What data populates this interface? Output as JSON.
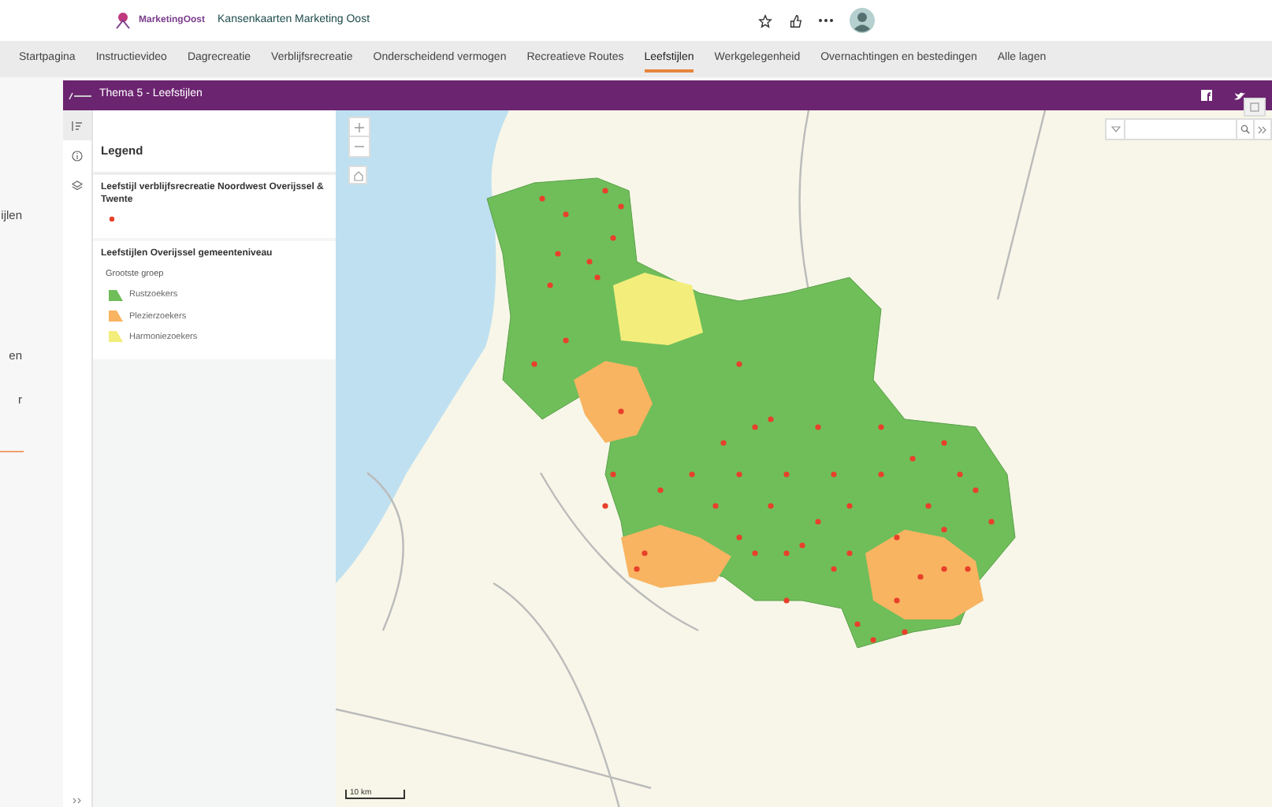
{
  "header": {
    "logo_text": "MarketingOost",
    "title": "Kansenkaarten Marketing Oost"
  },
  "nav": [
    {
      "label": "Startpagina",
      "selected": false
    },
    {
      "label": "Instructievideo",
      "selected": false
    },
    {
      "label": "Dagrecreatie",
      "selected": false
    },
    {
      "label": "Verblijfsrecreatie",
      "selected": false
    },
    {
      "label": "Onderscheidend vermogen",
      "selected": false
    },
    {
      "label": "Recreatieve Routes",
      "selected": false
    },
    {
      "label": "Leefstijlen",
      "selected": true
    },
    {
      "label": "Werkgelegenheid",
      "selected": false
    },
    {
      "label": "Overnachtingen en bestedingen",
      "selected": false
    },
    {
      "label": "Alle lagen",
      "selected": false
    }
  ],
  "background_page": {
    "fragments": [
      "ijlen",
      "en",
      "r"
    ]
  },
  "app": {
    "title": "Thema 5 - Leefstijlen",
    "side_tools": [
      {
        "selected": true
      },
      {
        "selected": false
      },
      {
        "selected": false
      }
    ],
    "legend": {
      "heading": "Legend",
      "layers": [
        {
          "title": "Leefstijl verblijfsrecreatie Noordwest Overijssel & Twente",
          "kind": "points",
          "items": [
            {
              "color": "#e8402a"
            }
          ]
        },
        {
          "title": "Leefstijlen Overijssel gemeenteniveau",
          "kind": "polygons",
          "group": "Grootste groep",
          "items": [
            {
              "label": "Rustzoekers",
              "color": "#6fbe5a"
            },
            {
              "label": "Plezierzoekers",
              "color": "#f8b461"
            },
            {
              "label": "Harmoniezoekers",
              "color": "#f3ee7c"
            }
          ]
        }
      ]
    },
    "scale": "10 km"
  }
}
